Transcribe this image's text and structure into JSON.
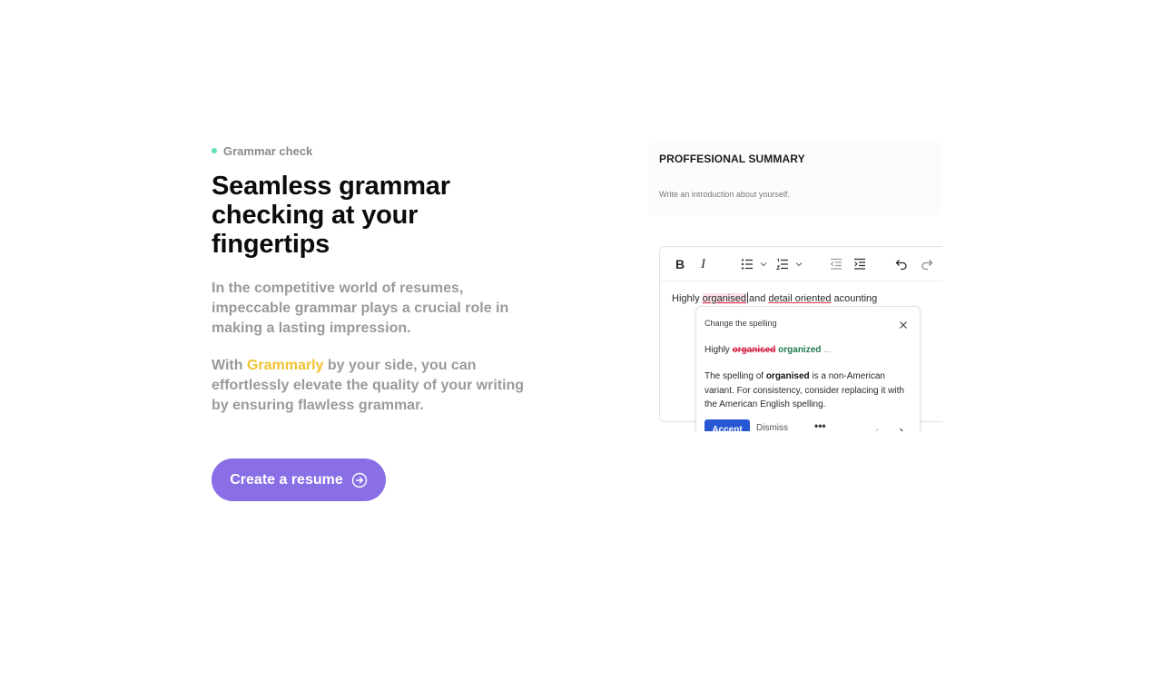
{
  "section": {
    "eyebrow": "Grammar check",
    "heading": "Seamless grammar checking at your fingertips",
    "paragraph1": "In the competitive world of resumes, impeccable grammar plays a crucial role in making a lasting impression.",
    "paragraph2_before": "With ",
    "paragraph2_highlight": "Grammarly",
    "paragraph2_after": " by your side, you can effortlessly elevate the quality of your writing by ensuring flawless grammar.",
    "cta_label": "Create a resume"
  },
  "colors": {
    "accent": "#8a6ee6",
    "highlight": "#f2c230",
    "dot": "#5fe0b5",
    "error": "#d01f3f",
    "suggestion": "#1f7a4f",
    "accept": "#2857d6"
  },
  "editor": {
    "section_title": "PROFFESIONAL SUMMARY",
    "section_subtitle": "Write an introduction about yourself.",
    "toolbar": {
      "bold": "B",
      "italic": "I",
      "icons": [
        "bold-icon",
        "italic-icon",
        "bullet-list-icon",
        "numbered-list-icon",
        "outdent-icon",
        "indent-icon",
        "undo-icon",
        "redo-icon"
      ]
    },
    "text_before": "Highly ",
    "text_error1": "organised",
    "text_middle": "and ",
    "text_error2": "detail oriented",
    "text_after": " acounting"
  },
  "suggestion": {
    "title": "Change the spelling",
    "line_prefix": "Highly ",
    "wrong": "organised",
    "right": "organized",
    "ellipsis": "...",
    "desc_before": "The spelling of ",
    "desc_word": "organised",
    "desc_after": " is a non-American variant. For consistency, consider replacing it with the American English spelling.",
    "accept": "Accept",
    "dismiss": "Dismiss",
    "more": "•••"
  }
}
